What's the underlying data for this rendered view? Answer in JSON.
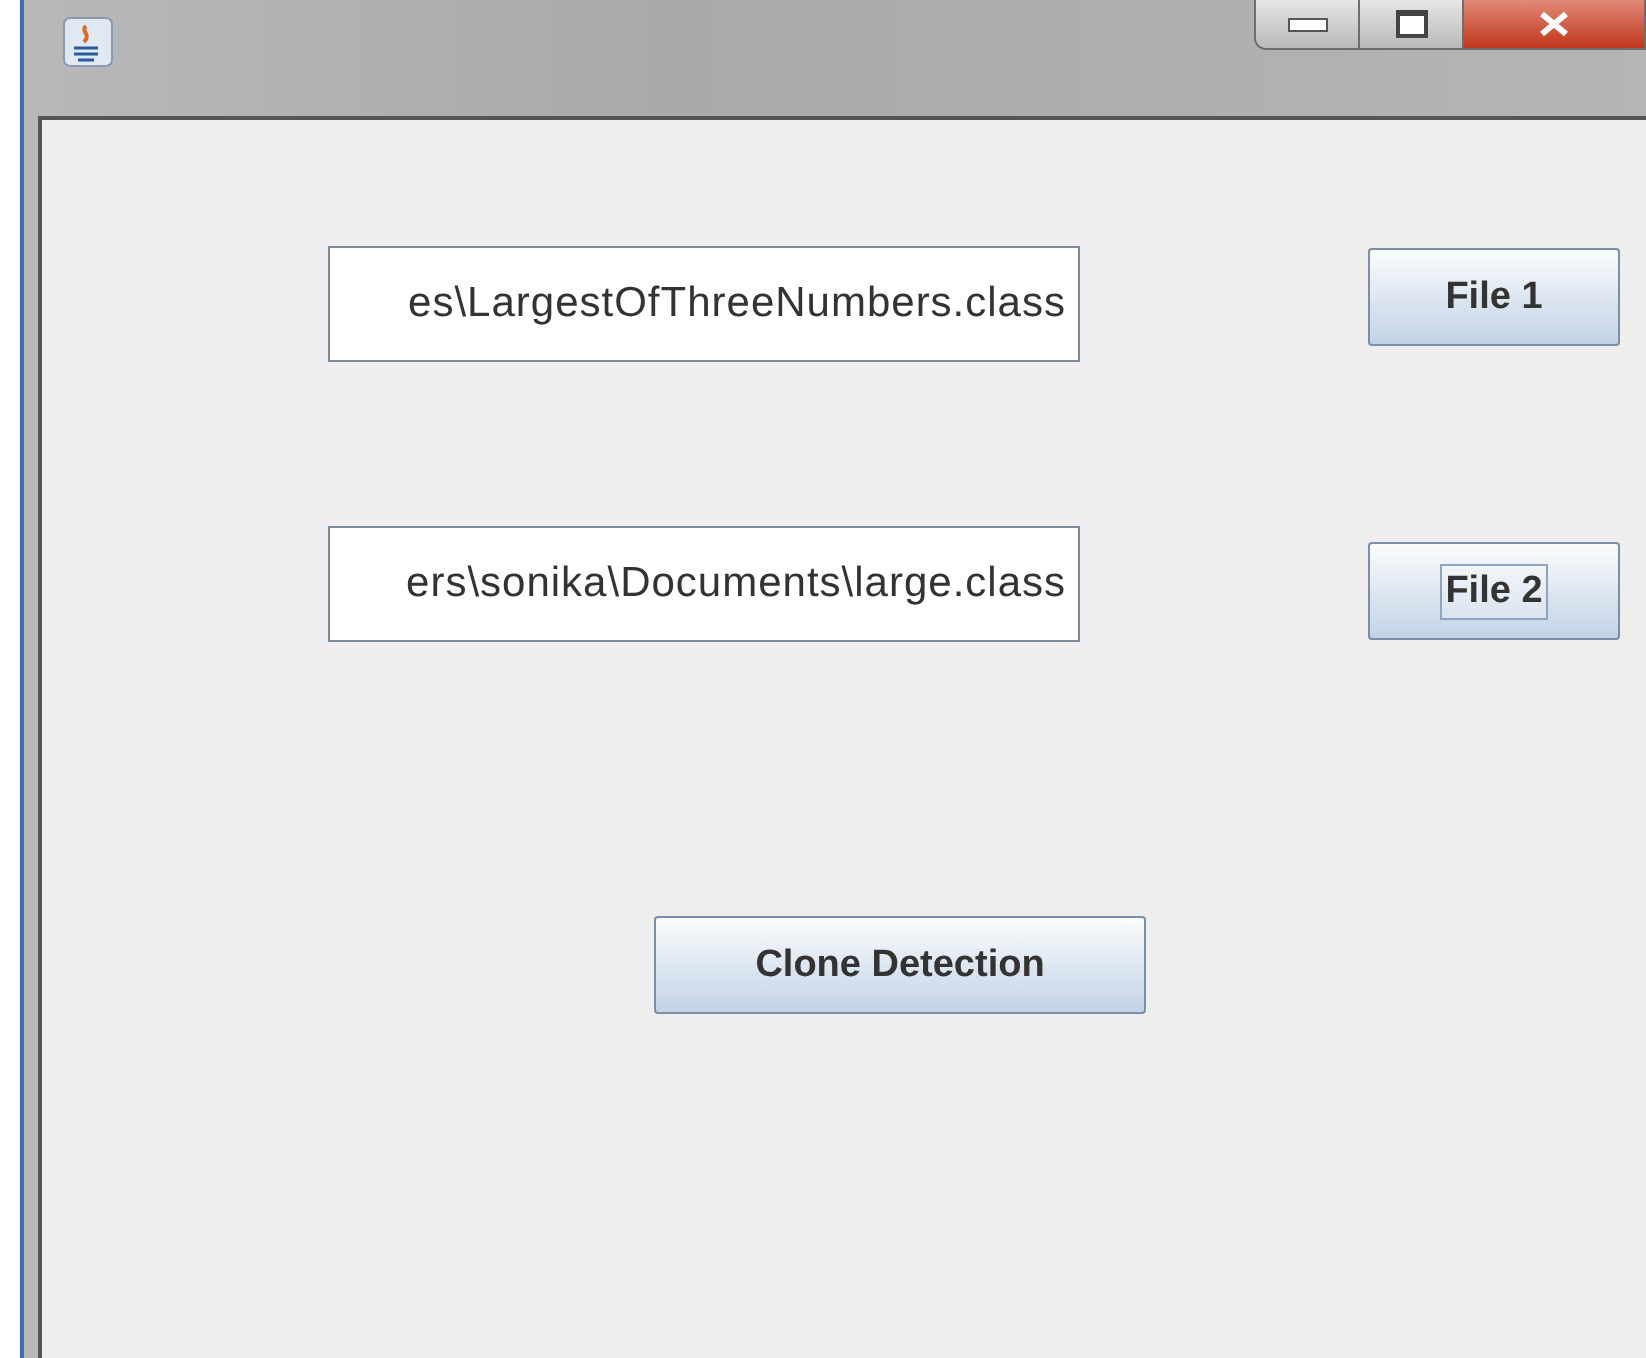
{
  "rows": [
    {
      "field": {
        "value": "es\\LargestOfThreeNumbers.class"
      },
      "button": {
        "label": "File 1",
        "focused": false
      }
    },
    {
      "field": {
        "value": "ers\\sonika\\Documents\\large.class"
      },
      "button": {
        "label": "File 2",
        "focused": true
      }
    }
  ],
  "action_button": {
    "label": "Clone Detection",
    "focused": false
  }
}
